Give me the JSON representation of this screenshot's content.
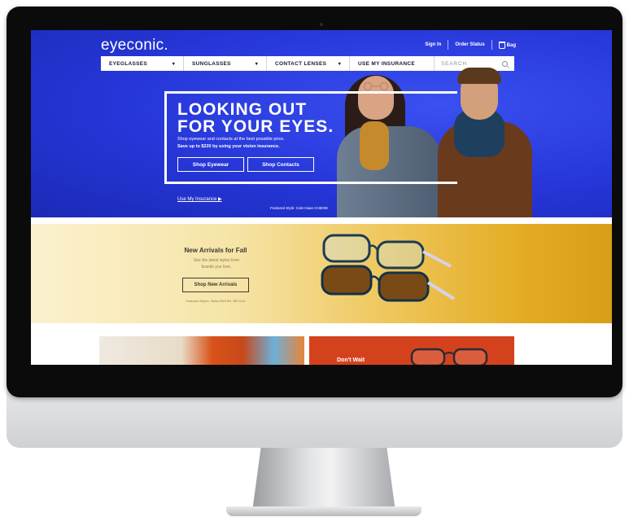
{
  "site": {
    "logo": "eyeconic.",
    "top_links": {
      "sign_in": "Sign In",
      "order_status": "Order Status",
      "bag": "Bag"
    }
  },
  "nav": {
    "items": [
      {
        "label": "EYEGLASSES",
        "caret": "▾"
      },
      {
        "label": "SUNGLASSES",
        "caret": "▾"
      },
      {
        "label": "CONTACT LENSES",
        "caret": "▾"
      },
      {
        "label": "USE MY INSURANCE"
      }
    ],
    "search_placeholder": "SEARCH"
  },
  "hero": {
    "title_line1": "LOOKING OUT",
    "title_line2": "FOR YOUR EYES.",
    "subtitle_line1": "Shop eyewear and contacts at the best possible price.",
    "subtitle_line2": "Save up to $220 by using your vision insurance.",
    "btn_eyewear": "Shop Eyewear",
    "btn_contacts": "Shop Contacts",
    "insurance_link": "Use My Insurance ▶",
    "featured": "Featured Style: Cole Haan CH5038"
  },
  "fall": {
    "title": "New Arrivals for Fall",
    "subtitle_line1": "See the latest styles from",
    "subtitle_line2": "brands you love.",
    "button": "Shop New Arrivals",
    "featured": "Featured Styles: Swiss BX5 BK, BB 1124"
  },
  "promo": {
    "right_text": "Don't Wait"
  },
  "colors": {
    "hero_blue": "#2636d8",
    "fall_gold": "#e3ab23",
    "promo_orange": "#d4421d"
  }
}
